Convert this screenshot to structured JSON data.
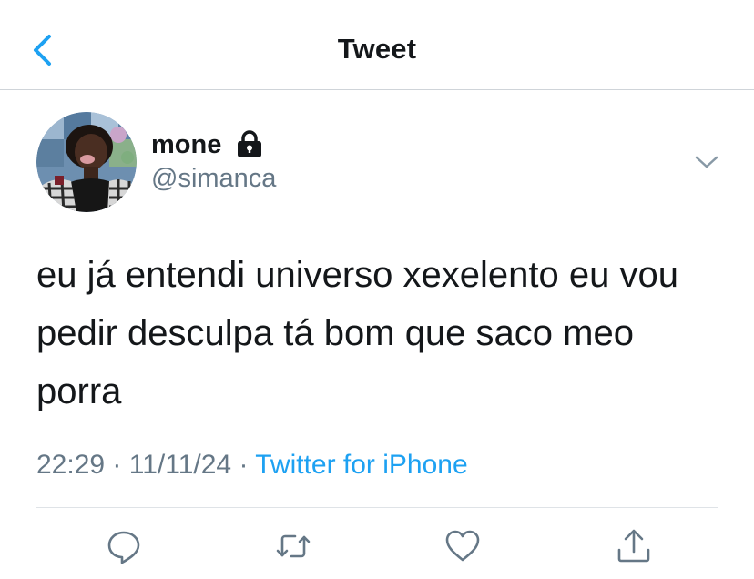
{
  "header": {
    "title": "Tweet",
    "back_icon": "chevron-left-icon"
  },
  "colors": {
    "accent": "#1da1f2",
    "text": "#14171a",
    "secondary_text": "#657786",
    "divider": "#cfd4d9"
  },
  "tweet": {
    "author": {
      "display_name": "mone",
      "handle": "@simanca",
      "protected_icon": "lock-icon",
      "avatar": "avatar-photo"
    },
    "text": "eu já entendi universo xexelento eu vou pedir desculpa tá bom que saco meo porra",
    "time": "22:29",
    "date": "11/11/24",
    "separator": "·",
    "source": "Twitter for iPhone"
  },
  "actions": [
    {
      "name": "reply",
      "icon": "reply-icon"
    },
    {
      "name": "retweet",
      "icon": "retweet-icon"
    },
    {
      "name": "like",
      "icon": "heart-icon"
    },
    {
      "name": "share",
      "icon": "share-icon"
    }
  ]
}
